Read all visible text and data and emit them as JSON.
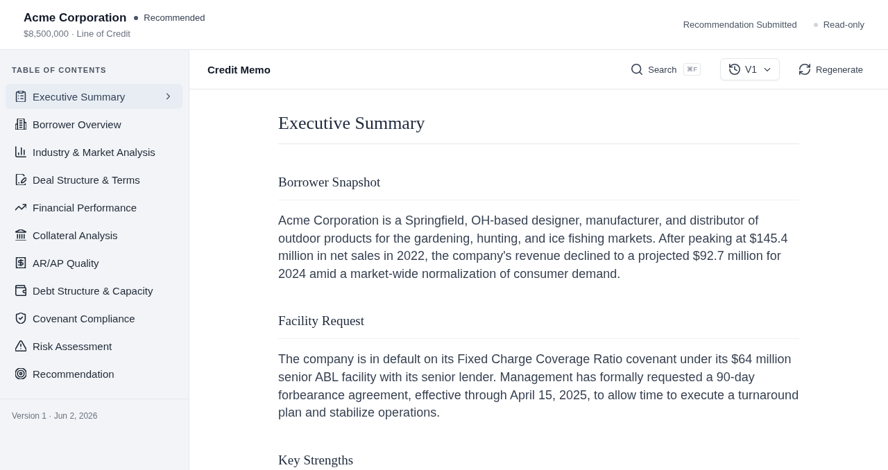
{
  "header": {
    "company": "Acme Corporation",
    "status": {
      "label": "Recommended",
      "color": "#475569"
    },
    "subtitle": "$8,500,000 · Line of Credit",
    "submission_status": "Recommendation Submitted",
    "access": {
      "label": "Read-only",
      "color": "#d1d5db"
    }
  },
  "sidebar": {
    "heading": "TABLE OF CONTENTS",
    "items": [
      {
        "label": "Executive Summary",
        "selected": true
      },
      {
        "label": "Borrower Overview",
        "selected": false
      },
      {
        "label": "Industry & Market Analysis",
        "selected": false
      },
      {
        "label": "Deal Structure & Terms",
        "selected": false
      },
      {
        "label": "Financial Performance",
        "selected": false
      },
      {
        "label": "Collateral Analysis",
        "selected": false
      },
      {
        "label": "AR/AP Quality",
        "selected": false
      },
      {
        "label": "Debt Structure & Capacity",
        "selected": false
      },
      {
        "label": "Covenant Compliance",
        "selected": false
      },
      {
        "label": "Risk Assessment",
        "selected": false
      },
      {
        "label": "Recommendation",
        "selected": false
      }
    ],
    "footer": "Version 1 · Jun 2, 2026"
  },
  "toolbar": {
    "title": "Credit Memo",
    "search": {
      "label": "Search",
      "shortcut": "⌘F"
    },
    "version": "V1",
    "regenerate": "Regenerate"
  },
  "document": {
    "title": "Executive Summary",
    "sections": [
      {
        "heading": "Borrower Snapshot",
        "body": "Acme Corporation is a Springfield, OH-based designer, manufacturer, and distributor of outdoor products for the gardening, hunting, and ice fishing markets. After peaking at $145.4 million in net sales in 2022, the company's revenue declined to a projected $92.7 million for 2024 amid a market-wide normalization of consumer demand."
      },
      {
        "heading": "Facility Request",
        "body": "The company is in default on its Fixed Charge Coverage Ratio covenant under its $64 million senior ABL facility with its senior lender. Management has formally requested a 90-day forbearance agreement, effective through April 15, 2025, to allow time to execute a turnaround plan and stabilize operations."
      },
      {
        "heading": "Key Strengths"
      }
    ]
  }
}
